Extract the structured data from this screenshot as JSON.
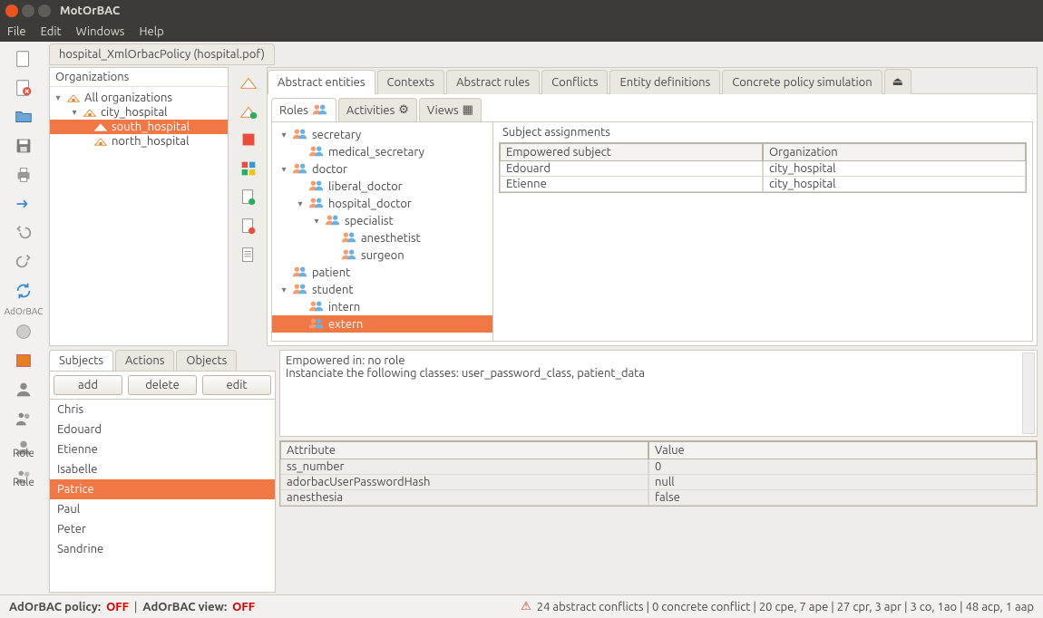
{
  "window_title": "MotOrBAC",
  "menu": [
    "File",
    "Edit",
    "Windows",
    "Help"
  ],
  "policy_title": "hospital_XmlOrbacPolicy (hospital.pof)",
  "org_panel": {
    "title": "Organizations",
    "tree": {
      "root": "All organizations",
      "children": [
        {
          "label": "city_hospital",
          "children": [
            {
              "label": "south_hospital",
              "selected": true
            },
            {
              "label": "north_hospital"
            }
          ]
        }
      ]
    }
  },
  "top_tabs": [
    "Abstract entities",
    "Contexts",
    "Abstract rules",
    "Conflicts",
    "Entity definitions",
    "Concrete policy simulation"
  ],
  "top_tab_active": 0,
  "sub_tabs": [
    "Roles",
    "Activities",
    "Views"
  ],
  "sub_tab_active": 0,
  "role_tree": [
    {
      "label": "secretary",
      "depth": 0,
      "exp": "▾"
    },
    {
      "label": "medical_secretary",
      "depth": 1,
      "exp": ""
    },
    {
      "label": "doctor",
      "depth": 0,
      "exp": "▾"
    },
    {
      "label": "liberal_doctor",
      "depth": 1,
      "exp": ""
    },
    {
      "label": "hospital_doctor",
      "depth": 1,
      "exp": "▾"
    },
    {
      "label": "specialist",
      "depth": 2,
      "exp": "▾"
    },
    {
      "label": "anesthetist",
      "depth": 3,
      "exp": ""
    },
    {
      "label": "surgeon",
      "depth": 3,
      "exp": ""
    },
    {
      "label": "patient",
      "depth": 0,
      "exp": ""
    },
    {
      "label": "student",
      "depth": 0,
      "exp": "▾"
    },
    {
      "label": "intern",
      "depth": 1,
      "exp": ""
    },
    {
      "label": "extern",
      "depth": 1,
      "exp": "",
      "selected": true
    }
  ],
  "assignments": {
    "title": "Subject assignments",
    "headers": [
      "Empowered subject",
      "Organization"
    ],
    "rows": [
      [
        "Edouard",
        "city_hospital"
      ],
      [
        "Etienne",
        "city_hospital"
      ]
    ]
  },
  "subjects": {
    "tabs": [
      "Subjects",
      "Actions",
      "Objects"
    ],
    "active": 0,
    "buttons": {
      "add": "add",
      "delete": "delete",
      "edit": "edit"
    },
    "list": [
      "Chris",
      "Edouard",
      "Etienne",
      "Isabelle",
      "Patrice",
      "Paul",
      "Peter",
      "Sandrine"
    ],
    "selected": "Patrice"
  },
  "detail": {
    "line1": "Empowered in:  no role",
    "line2": "Instanciate the following classes: user_password_class, patient_data"
  },
  "attributes": {
    "headers": [
      "Attribute",
      "Value"
    ],
    "rows": [
      [
        "ss_number",
        "0"
      ],
      [
        "adorbacUserPasswordHash",
        "null"
      ],
      [
        "anesthesia",
        "false"
      ]
    ]
  },
  "status": {
    "policy_label": "AdOrBAC policy:",
    "policy_val": "OFF",
    "view_label": "AdOrBAC view:",
    "view_val": "OFF",
    "conflicts": "24 abstract conflicts | 0 concrete conflict | 20 cpe, 7 ape | 27 cpr, 3 apr | 3 co, 1ao | 48 acp, 1 aap"
  },
  "adorbac_label": "AdOrBAC"
}
